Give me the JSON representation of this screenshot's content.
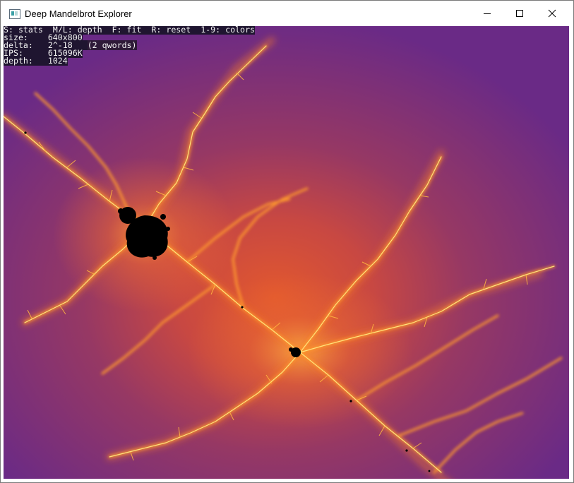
{
  "window": {
    "title": "Deep Mandelbrot Explorer",
    "icon": "app-window-icon",
    "controls": {
      "minimize": "minimize-icon",
      "maximize": "maximize-icon",
      "close": "close-icon"
    }
  },
  "overlay": {
    "help": "S: stats  M/L: depth  F: fit  R: reset  1-9: colors",
    "size_label": "size:",
    "size_value": "640x800",
    "delta_label": "delta:",
    "delta_value": "2^-18",
    "delta_note": "(2 qwords)",
    "ips_label": "IPS:",
    "ips_value": "615096K",
    "depth_label": "depth:",
    "depth_value": "1024"
  },
  "colors": {
    "background_purple": "#6b2a86",
    "glow_orange": "#e65a2a",
    "filament_yellow": "#ffd24a",
    "set_black": "#000000"
  }
}
